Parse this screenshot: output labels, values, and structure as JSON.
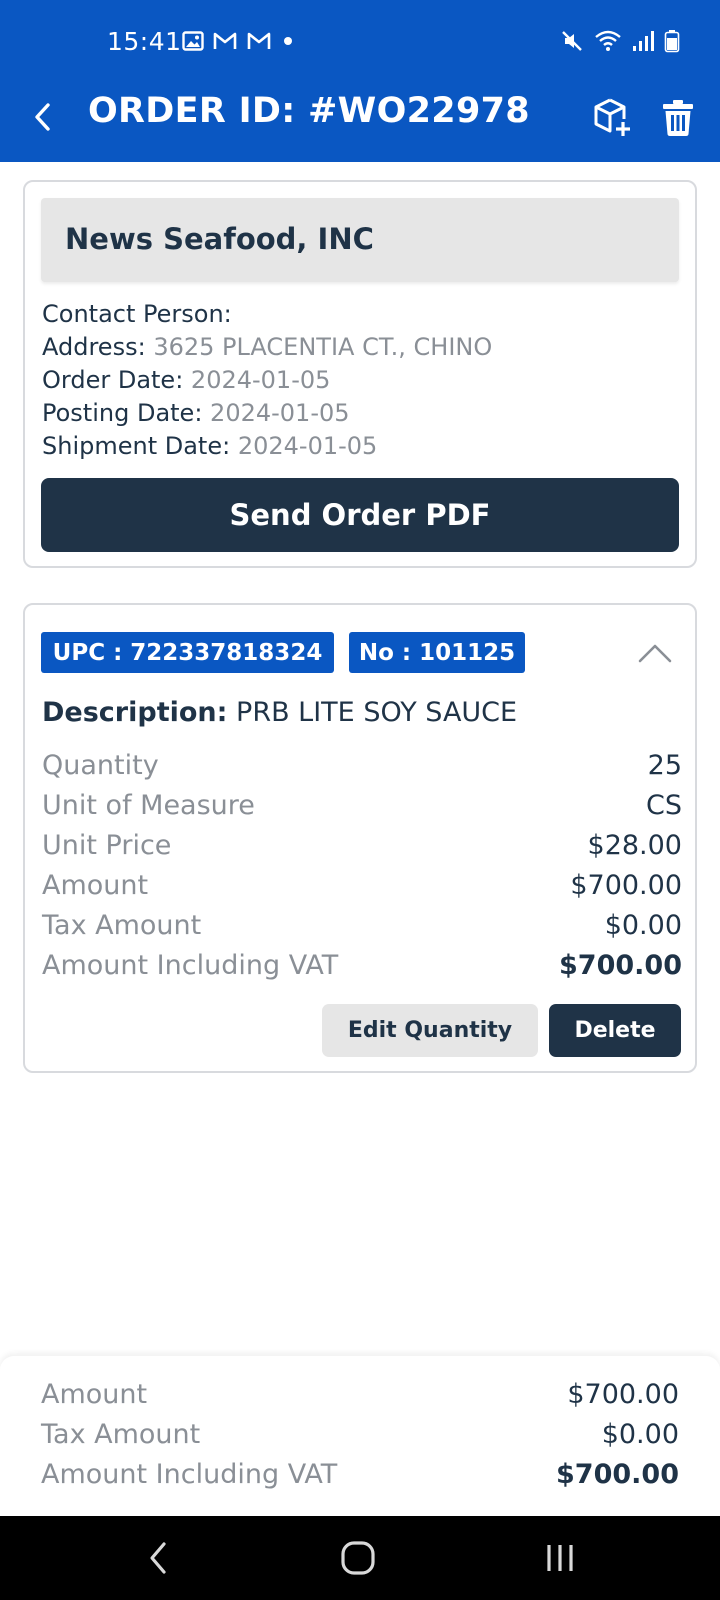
{
  "status_bar": {
    "time": "15:41",
    "left_icons": [
      "gallery-icon",
      "gmail-icon",
      "gmail-icon",
      "dot-icon"
    ],
    "right_icons": [
      "mute-icon",
      "wifi-icon",
      "signal-icon",
      "battery-icon"
    ]
  },
  "header": {
    "title": "ORDER ID: #WO22978",
    "background_color": "#0a57c2",
    "actions": [
      "add-box-icon",
      "trash-icon"
    ]
  },
  "customer": {
    "name": "News Seafood, INC",
    "fields": [
      {
        "label": "Contact Person:",
        "value": ""
      },
      {
        "label": "Address:",
        "value": "3625 PLACENTIA CT., CHINO"
      },
      {
        "label": "Order Date:",
        "value": "2024-01-05"
      },
      {
        "label": "Posting Date:",
        "value": "2024-01-05"
      },
      {
        "label": "Shipment Date:",
        "value": "2024-01-05"
      }
    ],
    "send_button_label": "Send Order PDF"
  },
  "line_item": {
    "upc_badge": "UPC : 722337818324",
    "no_badge": "No : 101125",
    "description_label": "Description:",
    "description_value": "PRB LITE SOY SAUCE",
    "rows": [
      {
        "label": "Quantity",
        "value": "25"
      },
      {
        "label": "Unit of Measure",
        "value": "CS"
      },
      {
        "label": "Unit Price",
        "value": "$28.00"
      },
      {
        "label": "Amount",
        "value": "$700.00"
      },
      {
        "label": "Tax Amount",
        "value": "$0.00"
      },
      {
        "label": "Amount Including VAT",
        "value": "$700.00"
      }
    ],
    "edit_button_label": "Edit Quantity",
    "delete_button_label": "Delete"
  },
  "totals": {
    "rows": [
      {
        "label": "Amount",
        "value": "$700.00"
      },
      {
        "label": "Tax Amount",
        "value": "$0.00"
      },
      {
        "label": "Amount Including VAT",
        "value": "$700.00"
      }
    ]
  },
  "colors": {
    "primary_blue": "#0a57c2",
    "dark_navy": "#1f3347",
    "muted_gray": "#8a8f96",
    "light_gray": "#e6e6e6"
  }
}
